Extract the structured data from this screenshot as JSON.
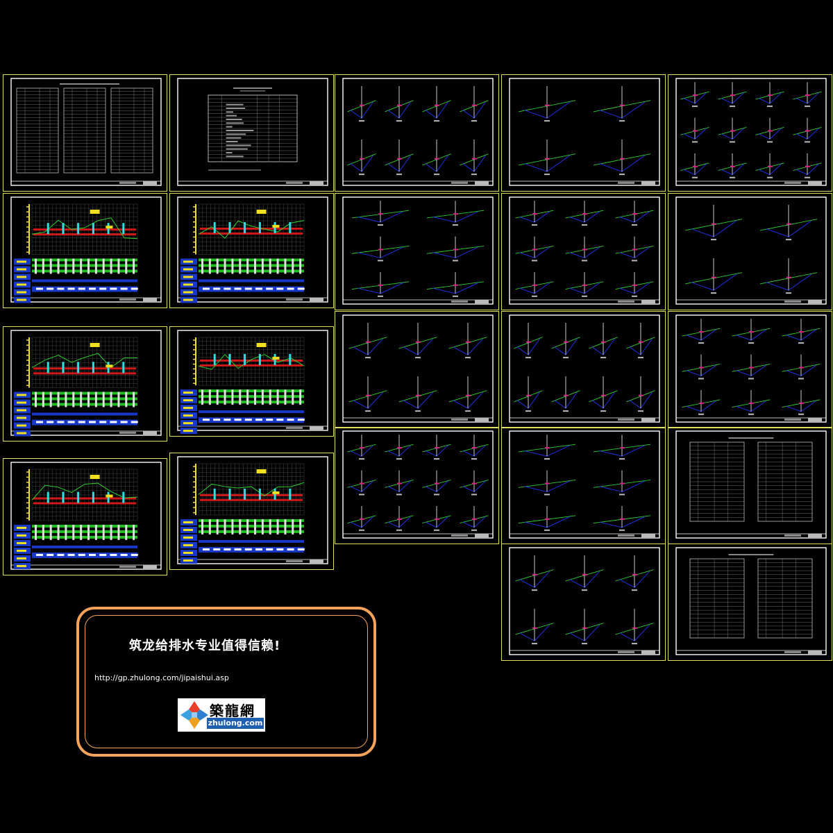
{
  "drawing": {
    "background": "#000000",
    "frame_color": "#e0e060",
    "border_color": "#ffffff",
    "sheet_types": {
      "table": "data tables sheet",
      "profile": "longitudinal profile sheet",
      "section": "cross-section sheet",
      "cover": "design notes table sheet"
    }
  },
  "promo": {
    "title": "筑龙给排水专业值得信赖!",
    "url": "http://gp.zhulong.com/jipaishui.asp",
    "border_color": "#f5a35a",
    "logo": {
      "icon": "zhulong-diamond-logo-icon",
      "name_cn": "築龍網",
      "name_en": "zhulong.com",
      "accent": "#1f5fb0"
    }
  }
}
